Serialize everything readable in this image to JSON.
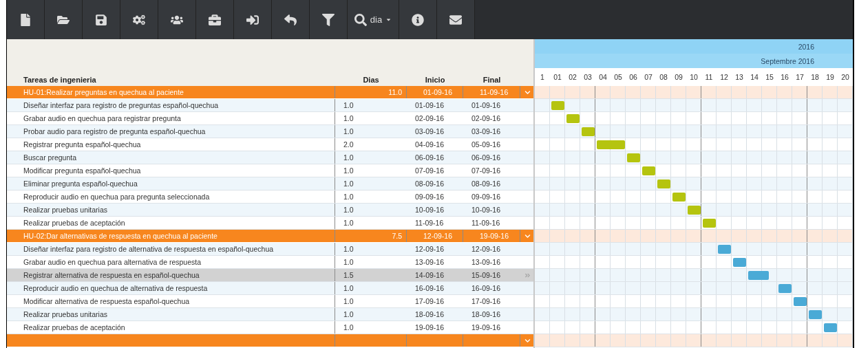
{
  "toolbar": {
    "zoom_label": "dia"
  },
  "table": {
    "columns": [
      "Tareas de ingenieria",
      "Dias",
      "Inicio",
      "Final"
    ],
    "groups": [
      {
        "name": "HU-01:Realizar preguntas en quechua al paciente",
        "dias": "11.0",
        "inicio": "01-09-16",
        "final": "11-09-16",
        "expanded": true,
        "color": "#b5c40f",
        "tasks": [
          {
            "name": "Diseñar interfaz para registro de preguntas español-quechua",
            "dias": "1.0",
            "inicio": "01-09-16",
            "final": "01-09-16",
            "selected": false
          },
          {
            "name": "Grabar audio en quechua para registrar pregunta",
            "dias": "1.0",
            "inicio": "02-09-16",
            "final": "02-09-16",
            "selected": false
          },
          {
            "name": "Probar audio para registro de pregunta español-quechua",
            "dias": "1.0",
            "inicio": "03-09-16",
            "final": "03-09-16",
            "selected": false
          },
          {
            "name": "Registrar pregunta español-quechua",
            "dias": "2.0",
            "inicio": "04-09-16",
            "final": "05-09-16",
            "selected": false
          },
          {
            "name": "Buscar pregunta",
            "dias": "1.0",
            "inicio": "06-09-16",
            "final": "06-09-16",
            "selected": false
          },
          {
            "name": "Modificar pregunta español-quechua",
            "dias": "1.0",
            "inicio": "07-09-16",
            "final": "07-09-16",
            "selected": false
          },
          {
            "name": "Eliminar pregunta español-quechua",
            "dias": "1.0",
            "inicio": "08-09-16",
            "final": "08-09-16",
            "selected": false
          },
          {
            "name": "Reproducir audio en quechua para pregunta seleccionada",
            "dias": "1.0",
            "inicio": "09-09-16",
            "final": "09-09-16",
            "selected": false
          },
          {
            "name": "Realizar pruebas unitarias",
            "dias": "1.0",
            "inicio": "10-09-16",
            "final": "10-09-16",
            "selected": false
          },
          {
            "name": "Realizar pruebas de aceptación",
            "dias": "1.0",
            "inicio": "11-09-16",
            "final": "11-09-16",
            "selected": false
          }
        ]
      },
      {
        "name": "HU-02:Dar alternativas de respuesta en quechua al paciente",
        "dias": "7.5",
        "inicio": "12-09-16",
        "final": "19-09-16",
        "expanded": true,
        "color": "#4aaad6",
        "tasks": [
          {
            "name": "Diseñar interfaz para registro de alternativa de respuesta en español-quechua",
            "dias": "1.0",
            "inicio": "12-09-16",
            "final": "12-09-16",
            "selected": false
          },
          {
            "name": "Grabar audio en quechua para alternativa de respuesta",
            "dias": "1.0",
            "inicio": "13-09-16",
            "final": "13-09-16",
            "selected": false
          },
          {
            "name": "Registrar alternativa de respuesta en español-quechua",
            "dias": "1.5",
            "inicio": "14-09-16",
            "final": "15-09-16",
            "selected": true
          },
          {
            "name": "Reproducir audio en quechua de alternativa de respuesta",
            "dias": "1.0",
            "inicio": "16-09-16",
            "final": "16-09-16",
            "selected": false
          },
          {
            "name": "Modificar alternativa de respuesta español-quechua",
            "dias": "1.0",
            "inicio": "17-09-16",
            "final": "17-09-16",
            "selected": false
          },
          {
            "name": "Realizar pruebas unitarias",
            "dias": "1.0",
            "inicio": "18-09-16",
            "final": "18-09-16",
            "selected": false
          },
          {
            "name": "Realizar pruebas de aceptación",
            "dias": "1.0",
            "inicio": "19-09-16",
            "final": "19-09-16",
            "selected": false
          }
        ]
      }
    ]
  },
  "gantt": {
    "year": "2016",
    "month": "Septembre 2016",
    "days": [
      "1",
      "01",
      "02",
      "03",
      "04",
      "05",
      "06",
      "07",
      "08",
      "09",
      "10",
      "11",
      "12",
      "13",
      "14",
      "15",
      "16",
      "17",
      "18",
      "19",
      "20"
    ]
  }
}
